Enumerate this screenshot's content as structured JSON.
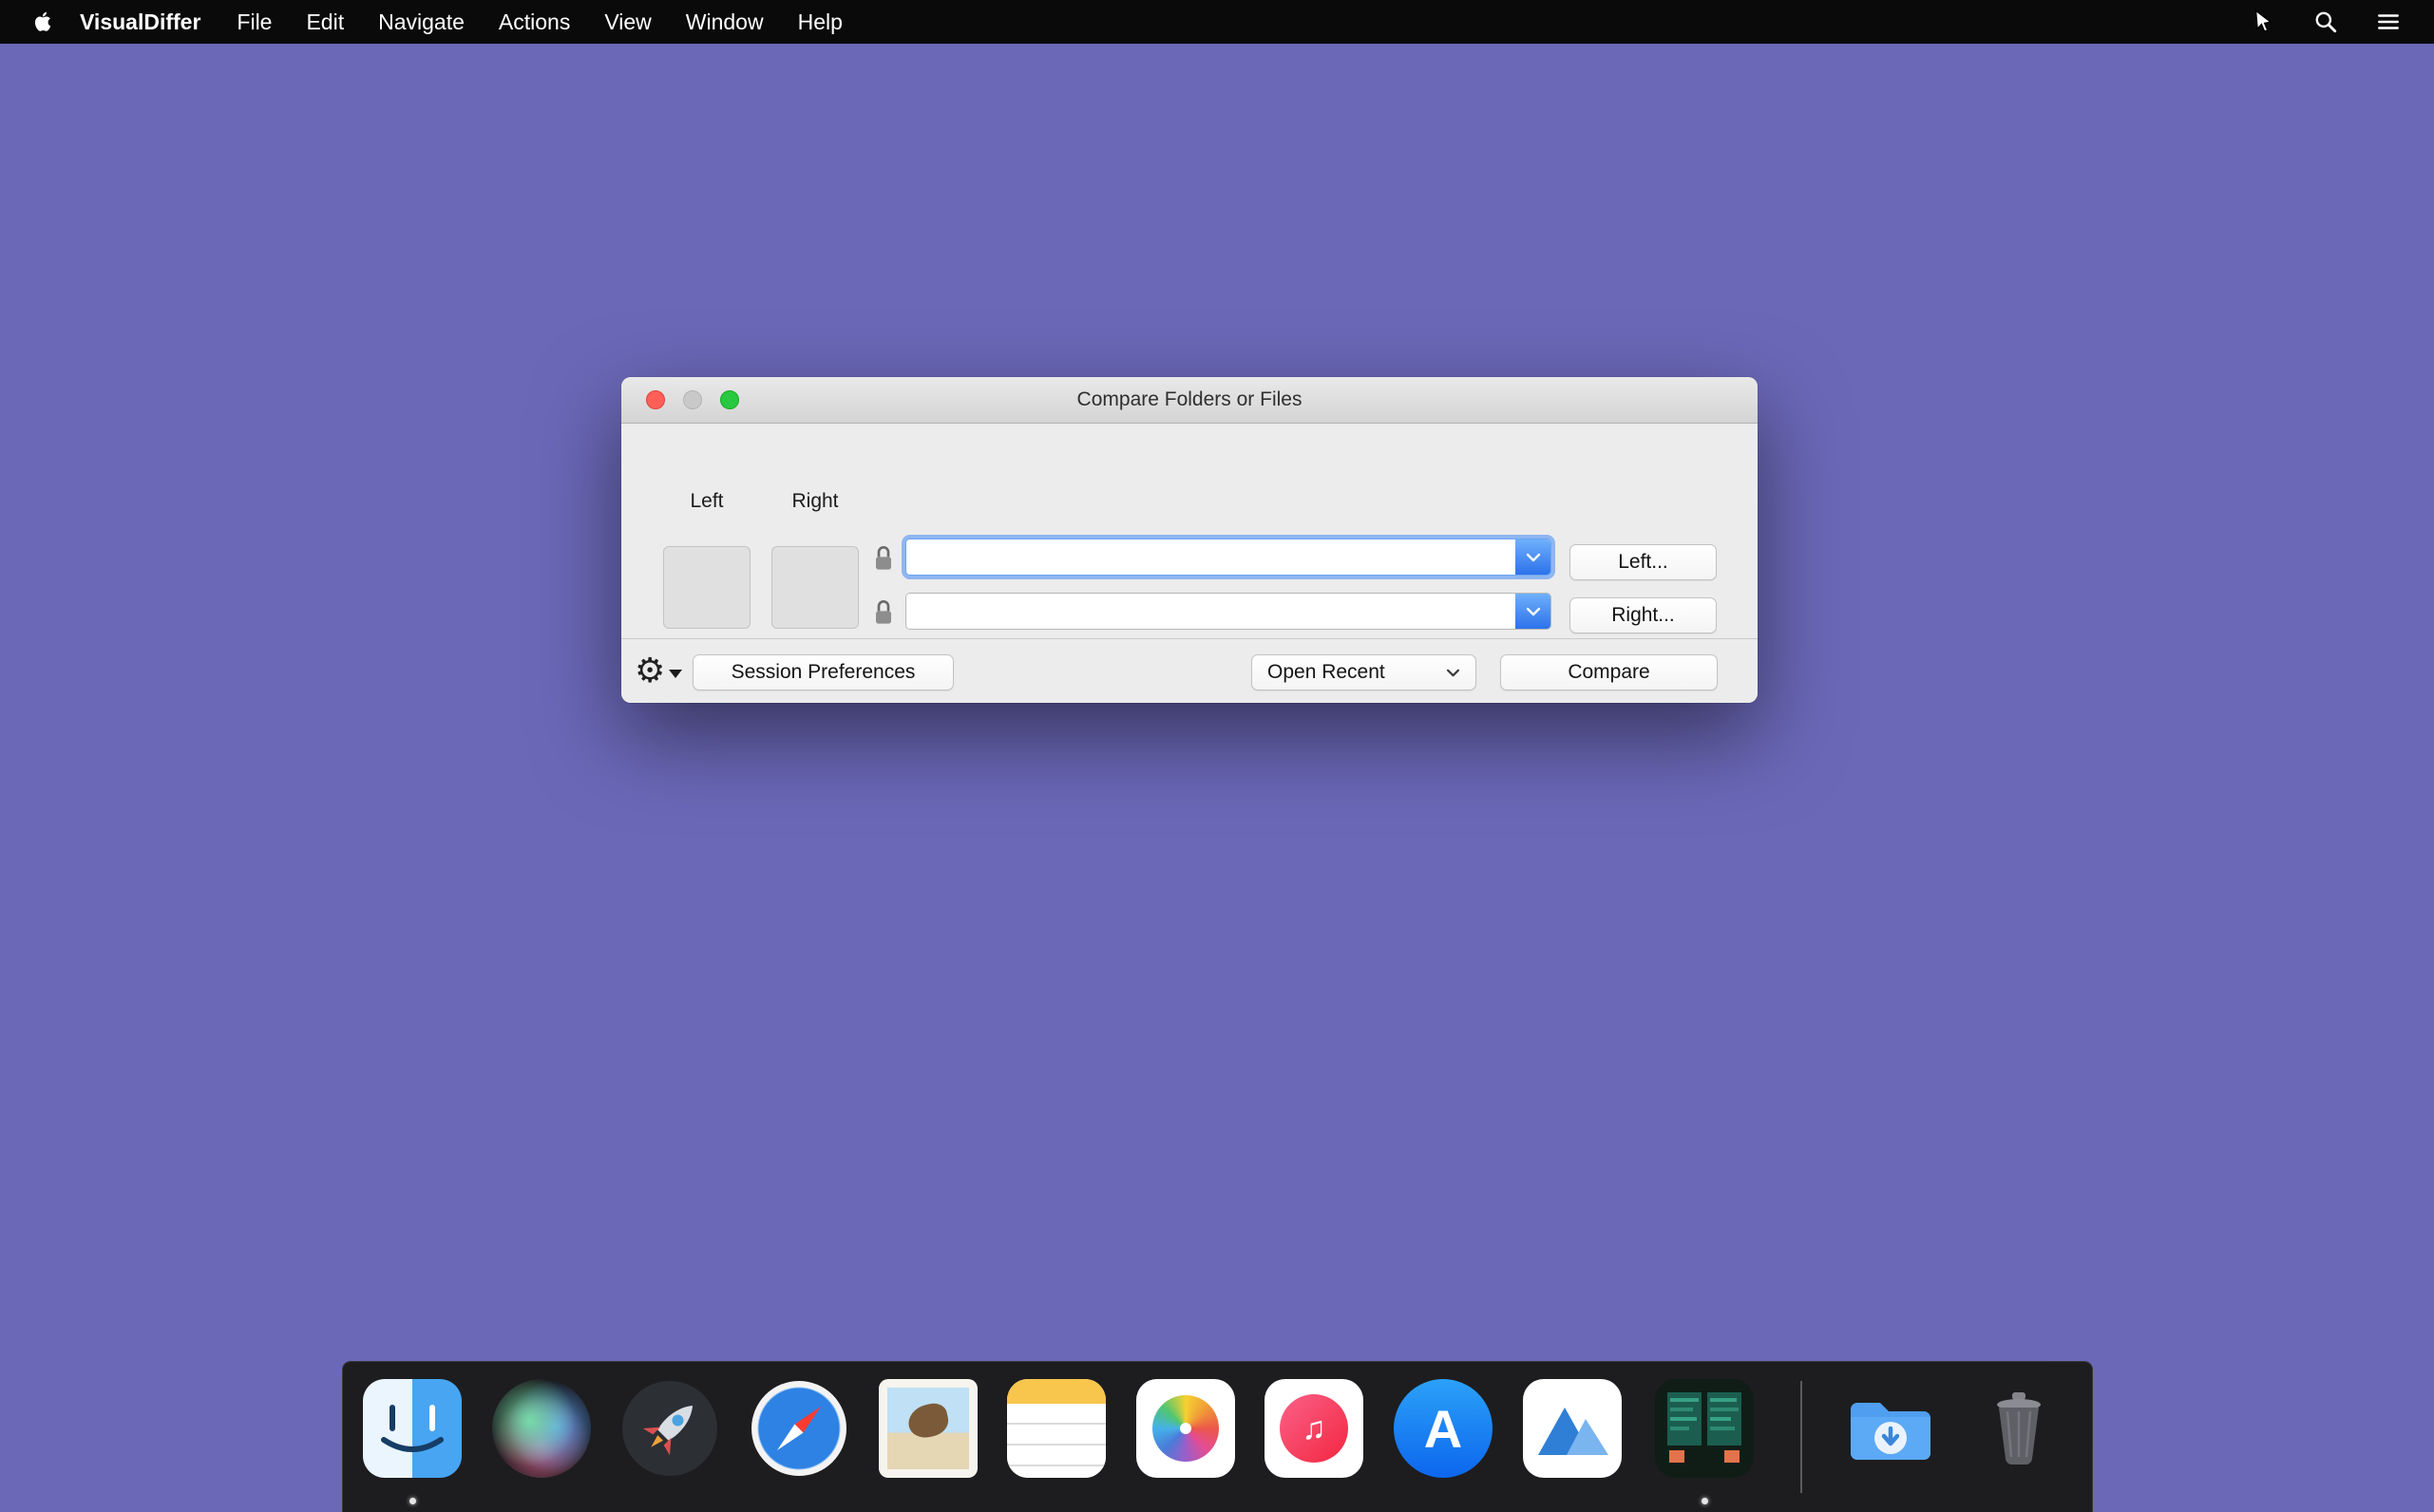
{
  "colors": {
    "desktop": "#6b68b8",
    "menu_bar_bg": "#0a0a0a",
    "accent_blue": "#2d72ea",
    "traffic_red": "#ff5f57",
    "traffic_disabled": "#c9c9c9",
    "traffic_green": "#28c840",
    "window_bg": "#ececec"
  },
  "menu_bar": {
    "app_name": "VisualDiffer",
    "items": [
      {
        "label": "File"
      },
      {
        "label": "Edit"
      },
      {
        "label": "Navigate"
      },
      {
        "label": "Actions"
      },
      {
        "label": "View"
      },
      {
        "label": "Window"
      },
      {
        "label": "Help"
      }
    ],
    "status_icons": [
      {
        "name": "pointer-cursor"
      },
      {
        "name": "spotlight-search"
      },
      {
        "name": "notification-center"
      }
    ]
  },
  "window": {
    "title": "Compare Folders or Files",
    "columns": {
      "left_label": "Left",
      "right_label": "Right"
    },
    "left_path": {
      "value": ""
    },
    "right_path": {
      "value": ""
    },
    "left_button": "Left...",
    "right_button": "Right...",
    "session_preferences_button": "Session Preferences",
    "open_recent_button": "Open Recent",
    "compare_button": "Compare"
  },
  "dock": {
    "items": [
      {
        "name": "finder",
        "running": true
      },
      {
        "name": "siri",
        "running": false
      },
      {
        "name": "launchpad",
        "running": false
      },
      {
        "name": "safari",
        "running": false
      },
      {
        "name": "mail",
        "running": false
      },
      {
        "name": "notes",
        "running": false
      },
      {
        "name": "photos",
        "running": false
      },
      {
        "name": "music",
        "running": false
      },
      {
        "name": "app-store",
        "running": false
      },
      {
        "name": "mountain-app",
        "running": false
      },
      {
        "name": "visualdiffer",
        "running": true
      },
      {
        "name": "downloads-folder",
        "running": false
      },
      {
        "name": "trash",
        "running": false
      }
    ]
  }
}
